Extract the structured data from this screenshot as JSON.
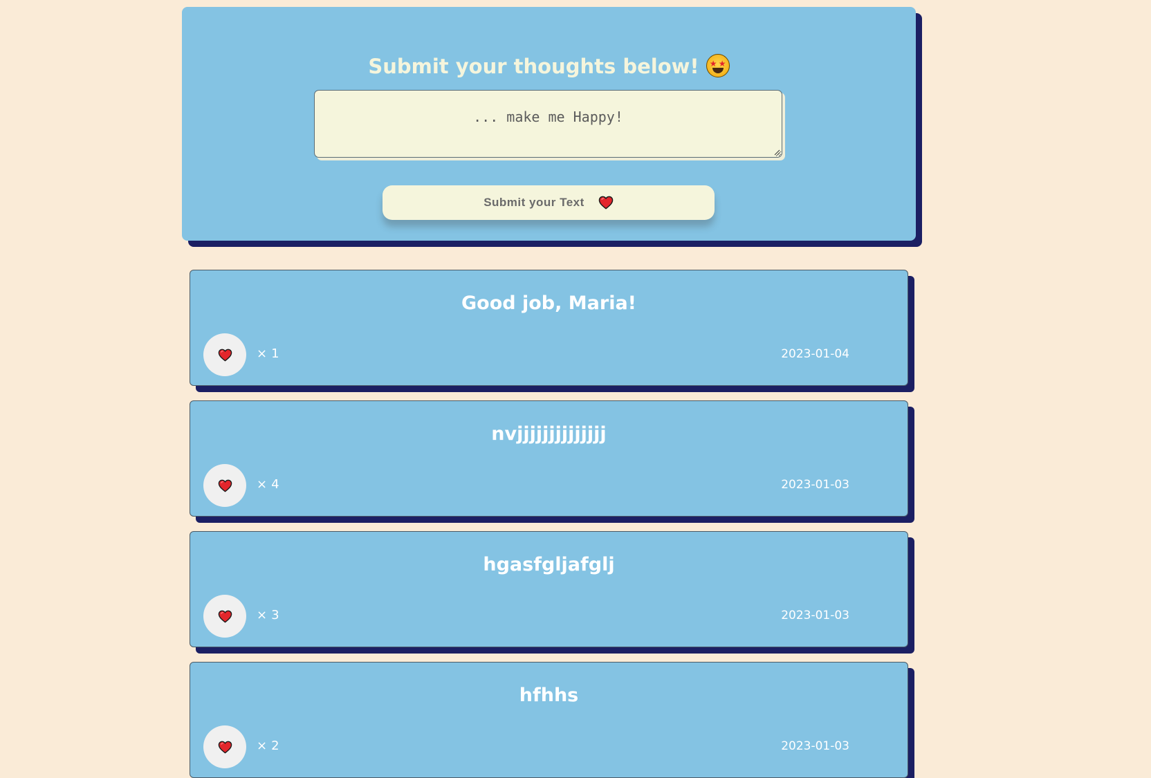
{
  "form": {
    "title": "Submit your thoughts below!",
    "title_emoji": "star-struck-emoji",
    "textarea_placeholder": "... make me Happy!",
    "textarea_value": "",
    "submit_label": "Submit your Text",
    "submit_icon": "heart-icon"
  },
  "thoughts": [
    {
      "message": "Good job, Maria!",
      "likes_prefix": "×",
      "likes": "1",
      "date": "2023-01-04"
    },
    {
      "message": "nvjjjjjjjjjjjjjj",
      "likes_prefix": "×",
      "likes": "4",
      "date": "2023-01-03"
    },
    {
      "message": "hgasfgljafglj",
      "likes_prefix": "×",
      "likes": "3",
      "date": "2023-01-03"
    },
    {
      "message": "hfhhs",
      "likes_prefix": "×",
      "likes": "2",
      "date": "2023-01-03"
    }
  ],
  "colors": {
    "page_background": "#faebd7",
    "card_background": "#84c3e3",
    "card_shadow": "#1b1f63",
    "input_background": "#f5f5dc",
    "title_text": "#f5f5dc",
    "heart": "#e3262c"
  }
}
